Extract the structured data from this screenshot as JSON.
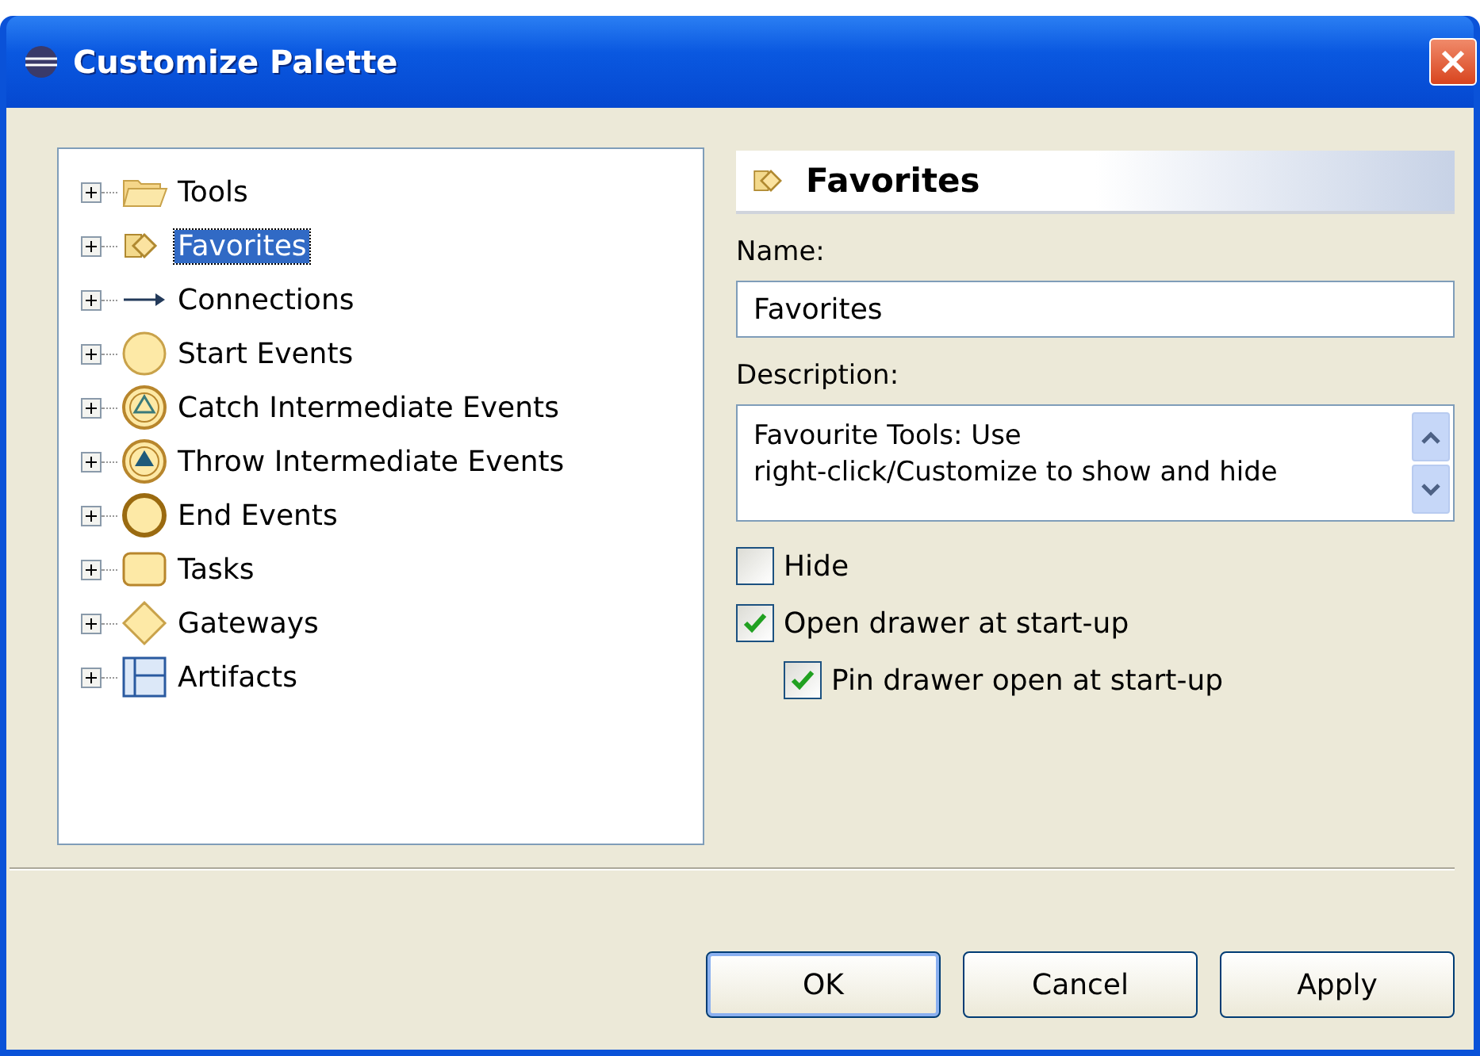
{
  "window": {
    "title": "Customize Palette"
  },
  "tree": {
    "items": [
      {
        "label": "Tools",
        "kind": "folder",
        "selected": false,
        "expanded": false
      },
      {
        "label": "Favorites",
        "kind": "favorites",
        "selected": true,
        "expanded": false
      },
      {
        "label": "Connections",
        "kind": "connection",
        "selected": false,
        "expanded": false
      },
      {
        "label": "Start Events",
        "kind": "start-event",
        "selected": false,
        "expanded": false
      },
      {
        "label": "Catch Intermediate Events",
        "kind": "catch-event",
        "selected": false,
        "expanded": false
      },
      {
        "label": "Throw Intermediate Events",
        "kind": "throw-event",
        "selected": false,
        "expanded": false
      },
      {
        "label": "End Events",
        "kind": "end-event",
        "selected": false,
        "expanded": false
      },
      {
        "label": "Tasks",
        "kind": "task",
        "selected": false,
        "expanded": false
      },
      {
        "label": "Gateways",
        "kind": "gateway",
        "selected": false,
        "expanded": false
      },
      {
        "label": "Artifacts",
        "kind": "artifact",
        "selected": false,
        "expanded": false
      }
    ]
  },
  "details": {
    "heading": "Favorites",
    "name_label": "Name:",
    "name_value": "Favorites",
    "description_label": "Description:",
    "description_value": "Favourite Tools: Use\nright-click/Customize to show and hide",
    "options": [
      {
        "label": "Hide",
        "checked": false,
        "indented": false
      },
      {
        "label": "Open drawer at start-up",
        "checked": true,
        "indented": false
      },
      {
        "label": "Pin drawer open at start-up",
        "checked": true,
        "indented": true
      }
    ]
  },
  "buttons": [
    {
      "label": "OK",
      "default": true
    },
    {
      "label": "Cancel",
      "default": false
    },
    {
      "label": "Apply",
      "default": false
    }
  ]
}
